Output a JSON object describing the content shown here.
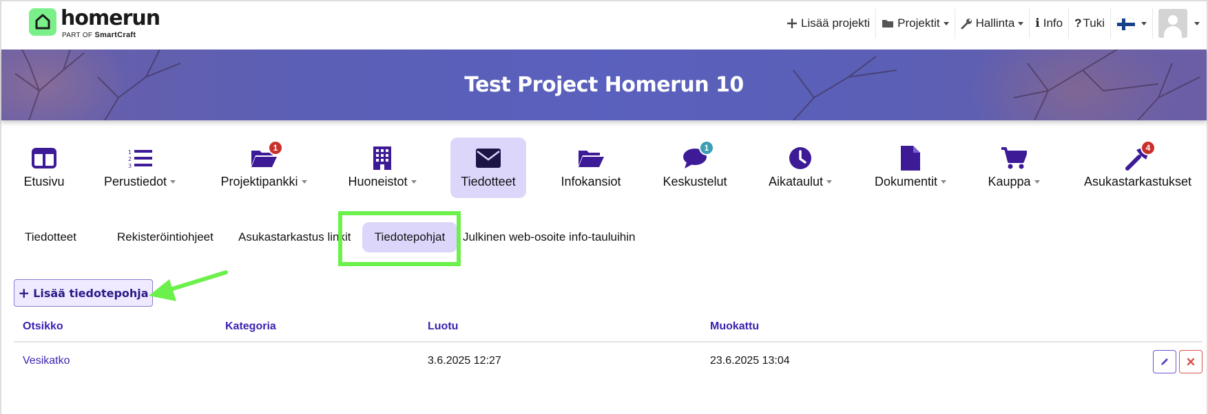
{
  "brand": {
    "name": "homerun",
    "sub_prefix": "PART OF",
    "sub_brand": "SmartCraft"
  },
  "topnav": {
    "add_project": "Lisää projekti",
    "projects": "Projektit",
    "admin": "Hallinta",
    "info": "Info",
    "support": "Tuki"
  },
  "banner": {
    "title": "Test Project Homerun 10"
  },
  "modules": [
    {
      "label": "Etusivu",
      "icon": "columns-icon"
    },
    {
      "label": "Perustiedot",
      "icon": "numbered-list-icon"
    },
    {
      "label": "Projektipankki",
      "icon": "folder-open-icon",
      "badge": "1"
    },
    {
      "label": "Huoneistot",
      "icon": "building-icon"
    },
    {
      "label": "Tiedotteet",
      "icon": "envelope-icon",
      "active": true
    },
    {
      "label": "Infokansiot",
      "icon": "folder-open-icon"
    },
    {
      "label": "Keskustelut",
      "icon": "chat-icon",
      "badge": "1"
    },
    {
      "label": "Aikataulut",
      "icon": "clock-icon"
    },
    {
      "label": "Dokumentit",
      "icon": "file-icon"
    },
    {
      "label": "Kauppa",
      "icon": "cart-icon"
    },
    {
      "label": "Asukastarkastukset",
      "icon": "hammer-icon",
      "badge": "4"
    }
  ],
  "subtabs": [
    {
      "label": "Tiedotteet"
    },
    {
      "label": "Rekisteröintiohjeet"
    },
    {
      "label": "Asukastarkastus linkit"
    },
    {
      "label": "Tiedotepohjat",
      "active": true
    },
    {
      "label": "Julkinen web-osoite info-tauluihin"
    }
  ],
  "add_button": {
    "label": "Lisää tiedotepohja"
  },
  "table": {
    "headers": [
      "Otsikko",
      "Kategoria",
      "Luotu",
      "Muokattu"
    ],
    "rows": [
      {
        "title": "Vesikatko",
        "category": "",
        "created": "3.6.2025 12:27",
        "modified": "23.6.2025 13:04"
      }
    ]
  },
  "colors": {
    "accent": "#3b1fb0",
    "icon": "#3d1a96",
    "active_bg": "#ddd6fb",
    "highlight": "#6cf04b",
    "badge_red": "#c9302c",
    "badge_teal": "#3a9fb3"
  }
}
